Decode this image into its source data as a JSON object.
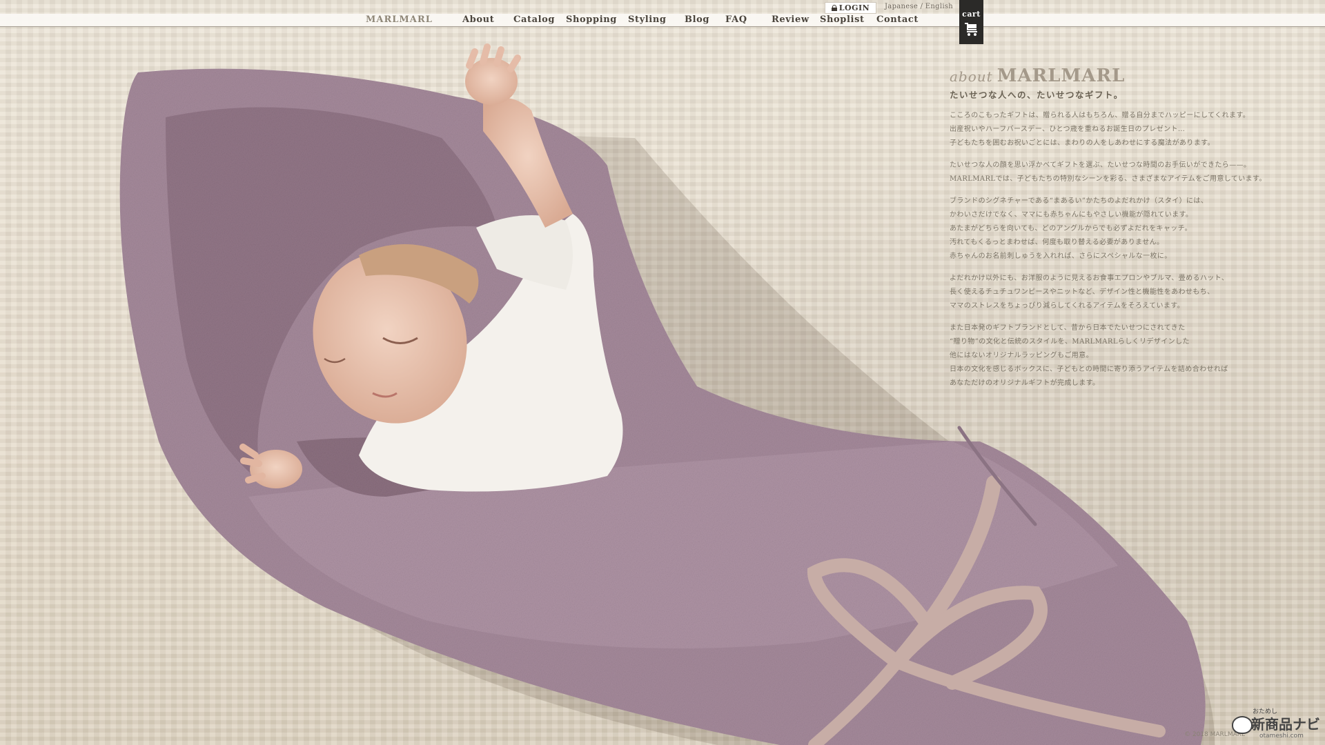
{
  "header": {
    "logo": "MARLMARL",
    "nav": [
      "About",
      "Catalog",
      "Shopping",
      "Styling",
      "Blog",
      "FAQ",
      "Review",
      "Shoplist",
      "Contact"
    ],
    "login_label": "LOGIN",
    "lang_japanese": "Japanese",
    "lang_sep": " / ",
    "lang_english": "English",
    "cart_label": "cart"
  },
  "about": {
    "title_small": "about",
    "title_big": "MARLMARL",
    "subtitle": "たいせつな人への、たいせつなギフト。",
    "paragraphs": [
      [
        "こころのこもったギフトは、贈られる人はもちろん、贈る自分までハッピーにしてくれます。",
        "出産祝いやハーフバースデー、ひとつ歳を重ねるお誕生日のプレゼント…",
        "子どもたちを囲むお祝いごとには、まわりの人をしあわせにする魔法があります。"
      ],
      [
        "たいせつな人の顔を思い浮かべてギフトを選ぶ、たいせつな時間のお手伝いができたら——。",
        "MARLMARLでは、子どもたちの特別なシーンを彩る、さまざまなアイテムをご用意しています。"
      ],
      [
        "ブランドのシグネチャーである“まあるい”かたちのよだれかけ（スタイ）には、",
        "かわいさだけでなく、ママにも赤ちゃんにもやさしい機能が隠れています。",
        "あたまがどちらを向いても、どのアングルからでも必ずよだれをキャッチ。",
        "汚れてもくるっとまわせば、何度も取り替える必要がありません。",
        "赤ちゃんのお名前刺しゅうを入れれば、さらにスペシャルな一枚に。"
      ],
      [
        "よだれかけ以外にも、お洋服のように見えるお食事エプロンやブルマ、畳めるハット、",
        "長く使えるチュチュワンピースやニットなど、デザイン性と機能性をあわせもち、",
        "ママのストレスをちょっぴり減らしてくれるアイテムをそろえています。"
      ],
      [
        "また日本発のギフトブランドとして、昔から日本でたいせつにされてきた",
        "“贈り物”の文化と伝統のスタイルを、MARLMARLらしくリデザインした",
        "他にはないオリジナルラッピングもご用意。",
        "日本の文化を感じるボックスに、子どもとの時間に寄り添うアイテムを詰め合わせれば",
        "あなただけのオリジナルギフトが完成します。"
      ]
    ]
  },
  "footer": {
    "copyright": "© 2018 MARLMARL"
  },
  "watermark": {
    "small": "おためし",
    "main": "新商品ナビ",
    "url": "otameshi.com"
  },
  "colors": {
    "blanket": "#a58a9b",
    "ribbon": "#c7ada6",
    "background": "#e8dfcf",
    "cart_bg": "#2b2a28"
  }
}
